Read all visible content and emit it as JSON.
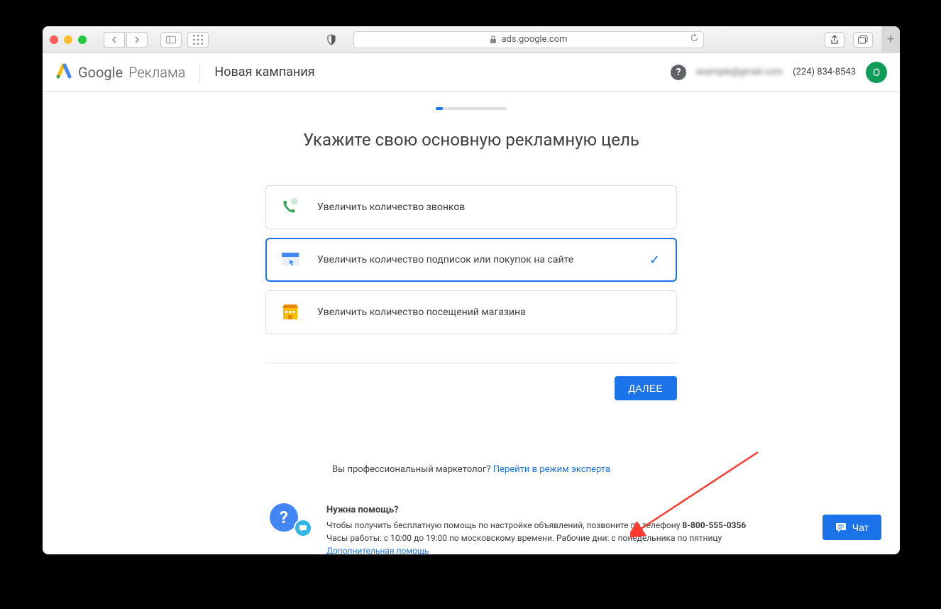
{
  "browser": {
    "url": "ads.google.com"
  },
  "header": {
    "google": "Google",
    "product": "Реклама",
    "title": "Новая кампания",
    "email": "example@gmail.com",
    "phone": "(224) 834-8543",
    "avatar_initial": "O"
  },
  "main": {
    "heading": "Укажите свою основную рекламную цель",
    "options": [
      {
        "label": "Увеличить количество звонков",
        "selected": false
      },
      {
        "label": "Увеличить количество подписок или покупок на сайте",
        "selected": true
      },
      {
        "label": "Увеличить количество посещений магазина",
        "selected": false
      }
    ],
    "next_button": "ДАЛЕЕ"
  },
  "expert": {
    "question": "Вы профессиональный маркетолог? ",
    "link": "Перейти в режим эксперта"
  },
  "help": {
    "title": "Нужна помощь?",
    "line1_prefix": "Чтобы получить бесплатную помощь по настройке объявлений, позвоните по телефону ",
    "phone": "8-800-555-0356",
    "line2": "Часы работы: с 10:00 до 19:00 по московскому времени. Рабочие дни: с понедельника по пятницу",
    "more_link": "Дополнительная помощь"
  },
  "chat_button": "Чат"
}
